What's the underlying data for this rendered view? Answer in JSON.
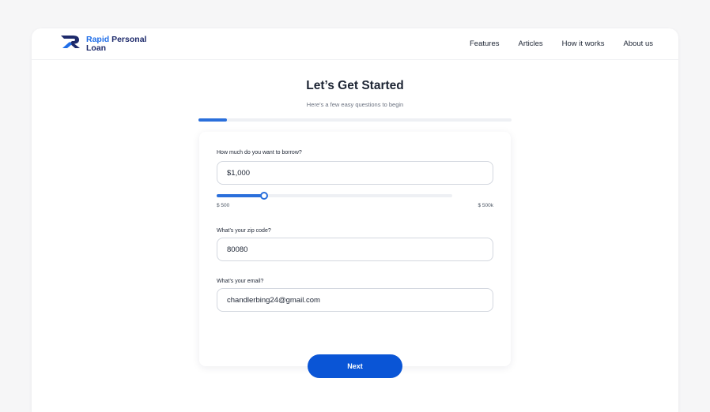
{
  "brand": {
    "name_accent": "Rapid",
    "name_rest": "Personal",
    "name_line2": "Loan",
    "logo_icon": "r-monogram-icon",
    "colors": {
      "primary": "#1d2a6b",
      "accent": "#1f6ee8"
    }
  },
  "nav": {
    "items": [
      {
        "label": "Features"
      },
      {
        "label": "Articles"
      },
      {
        "label": "How it works"
      },
      {
        "label": "About us"
      }
    ]
  },
  "page": {
    "title": "Let’s Get Started",
    "subtitle": "Here’s a few easy questions to begin",
    "progress": 0.09
  },
  "form": {
    "amount": {
      "label": "How much do you want to borrow?",
      "value": "$1,000",
      "slider_fraction": 0.2,
      "min_label": "$ 500",
      "max_label": "$ 500k"
    },
    "zip": {
      "label": "What’s your zip code?",
      "value": "80080"
    },
    "email": {
      "label": "What’s your email?",
      "value": "chandlerbing24@gmail.com"
    },
    "next_label": "Next"
  },
  "colors": {
    "button": "#0a55d6",
    "progress": "#2a6fdb"
  }
}
